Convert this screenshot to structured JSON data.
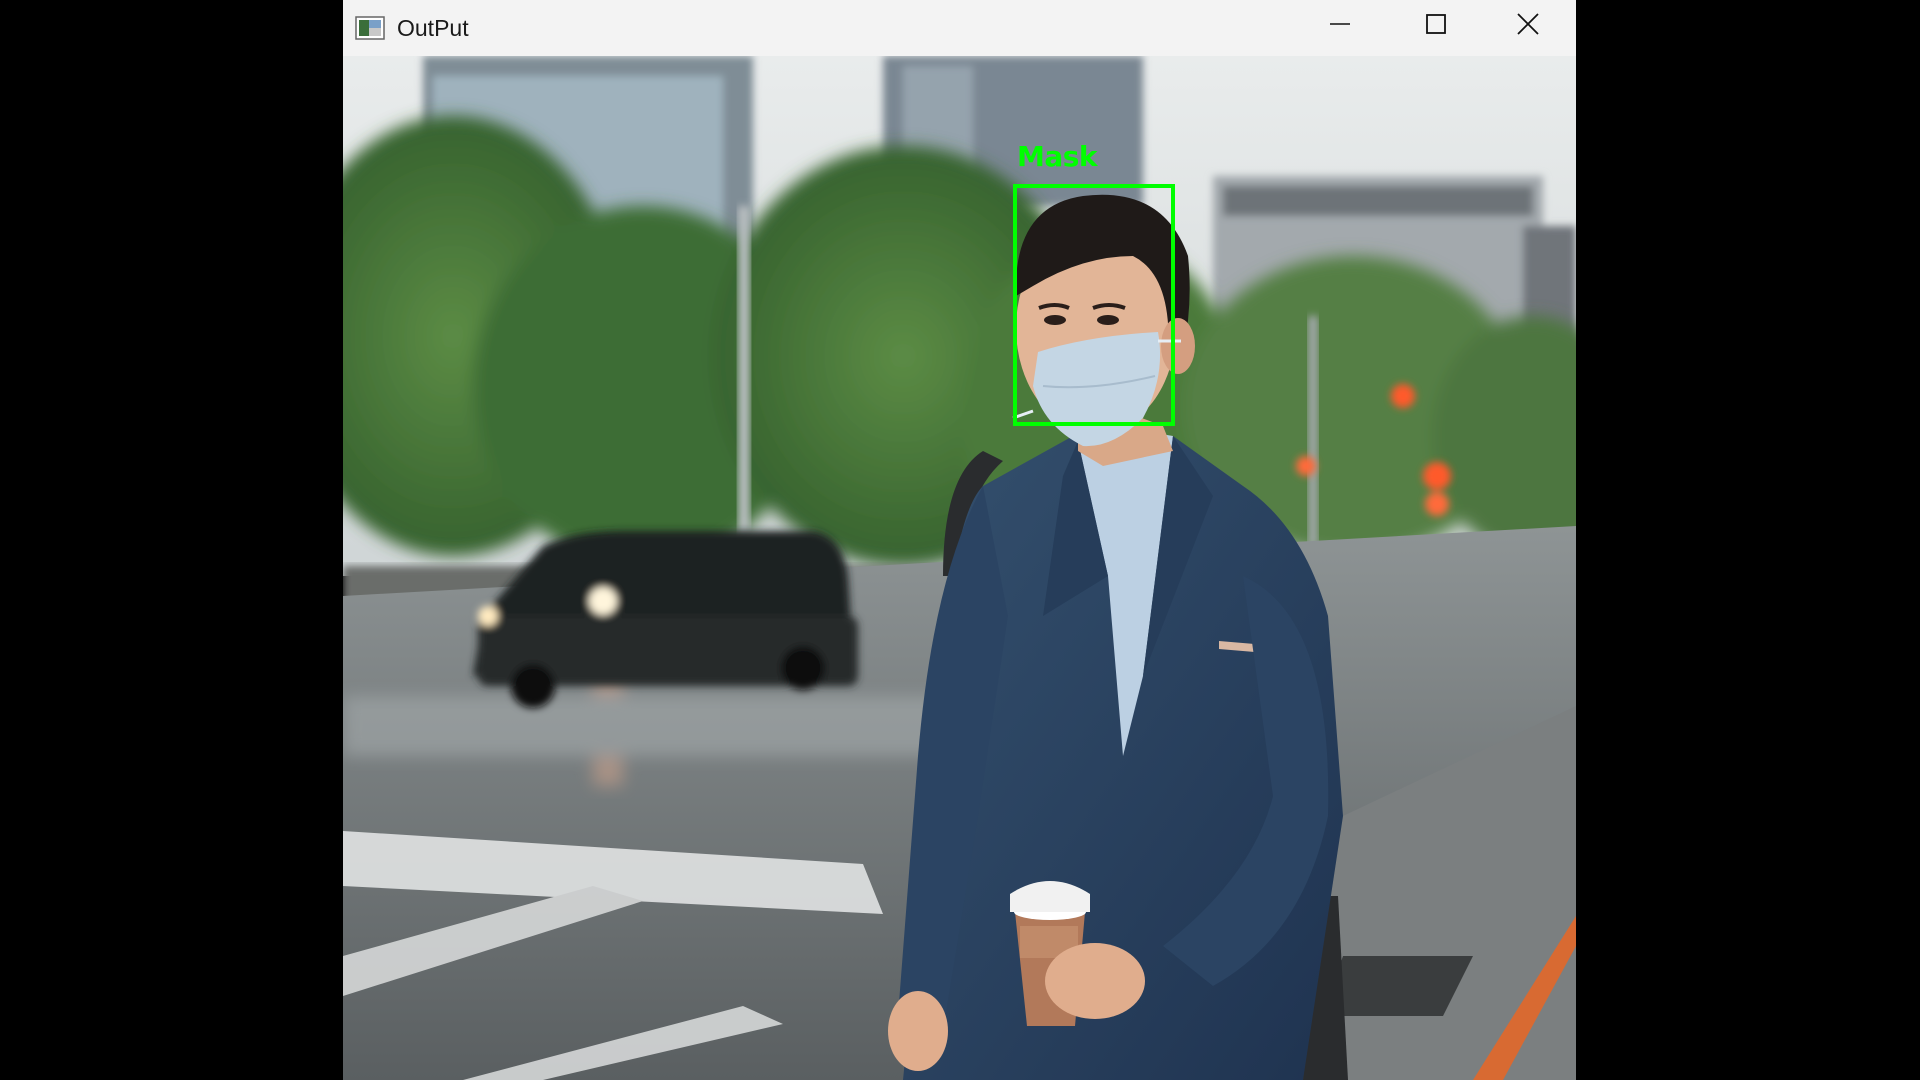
{
  "window": {
    "title": "OutPut",
    "icon": "image-window-icon",
    "controls": [
      "minimize-icon",
      "maximize-icon",
      "close-icon"
    ]
  },
  "detection": {
    "label": "Mask",
    "box_color": "#00ff00"
  },
  "colors": {
    "titlebar": "#f3f3f3",
    "background": "#000000",
    "detection_green": "#00ff00"
  }
}
